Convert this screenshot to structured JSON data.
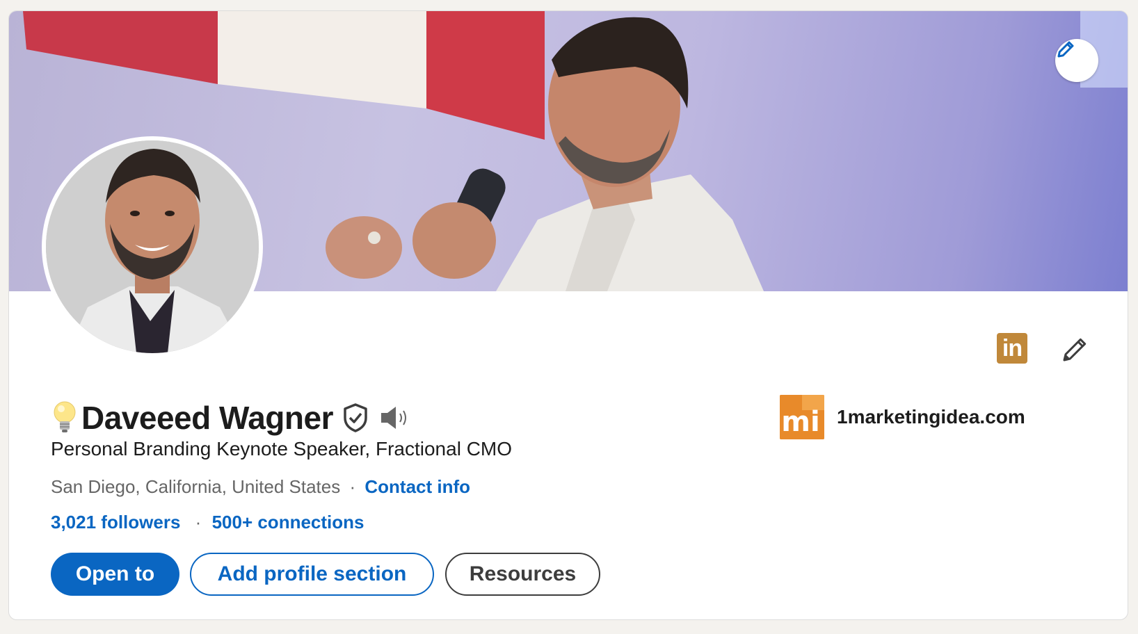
{
  "profile": {
    "name": "Daveeed Wagner",
    "headline": "Personal Branding Keynote Speaker, Fractional CMO",
    "location": "San Diego, California, United States",
    "separator": "·",
    "contact_info_label": "Contact info",
    "followers_label": "3,021 followers",
    "connections_label": "500+ connections"
  },
  "company": {
    "name": "1marketingidea.com",
    "logo_text": "mi"
  },
  "buttons": {
    "open_to": "Open to",
    "add_profile_section": "Add profile section",
    "resources": "Resources"
  },
  "icons": {
    "linkedin_icon_text": "in",
    "bulb": "lightbulb-icon",
    "verified": "shield-check-icon",
    "pronunciation": "speaker-icon",
    "edit_cover": "pencil-icon",
    "edit_profile": "pencil-icon"
  },
  "colors": {
    "accent": "#0a66c2",
    "linkedin_badge": "#c0883a",
    "company_logo": "#e88a2a"
  }
}
